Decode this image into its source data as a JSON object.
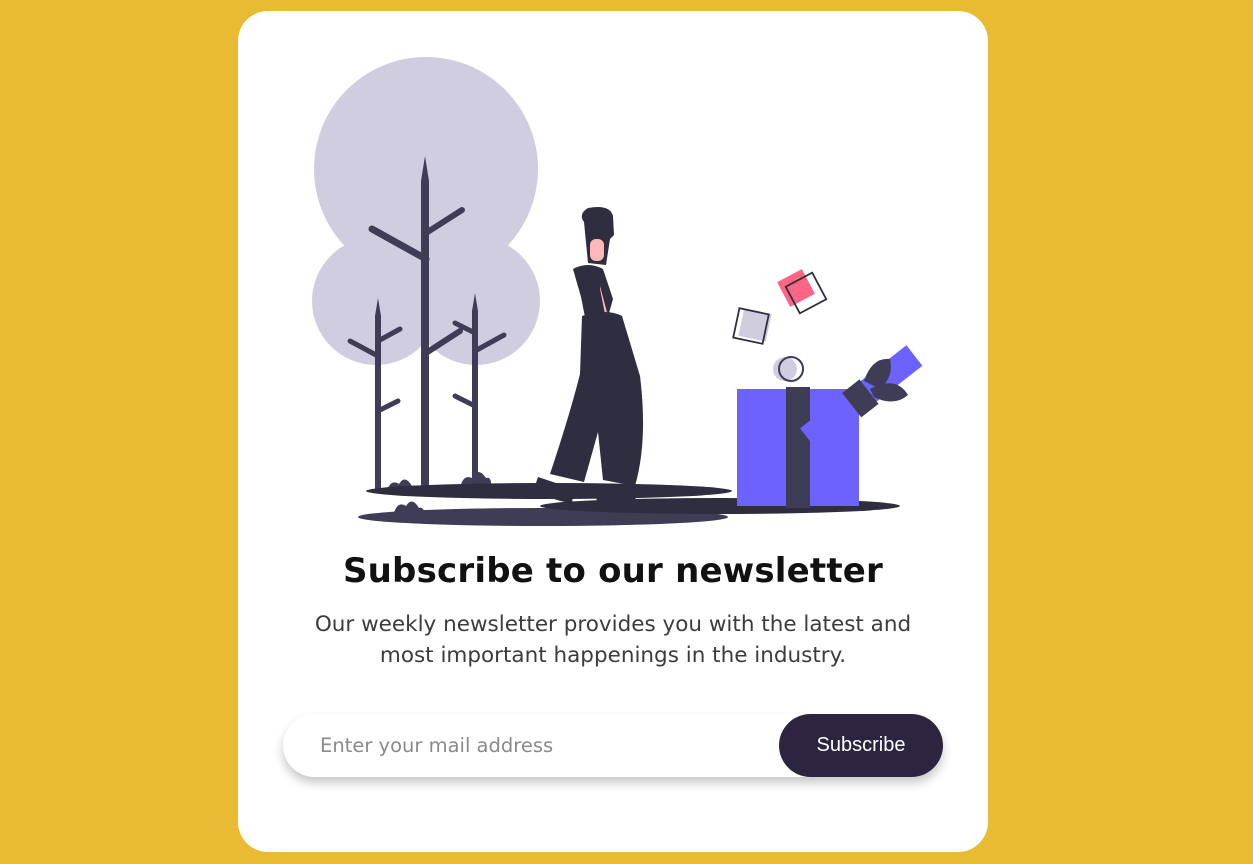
{
  "page": {
    "background_color": "#E9BB32"
  },
  "card": {
    "title": "Subscribe to our newsletter",
    "description": "Our weekly newsletter provides you with the latest and most important happenings in the industry.",
    "email_input": {
      "placeholder": "Enter your mail address",
      "value": ""
    },
    "subscribe_label": "Subscribe"
  },
  "colors": {
    "accent": "#6C63FF",
    "dark": "#2F2E41",
    "tree_light": "#D0CDE1",
    "pink": "#FF6584",
    "skin": "#FFB8B8",
    "button": "#2D2540"
  }
}
